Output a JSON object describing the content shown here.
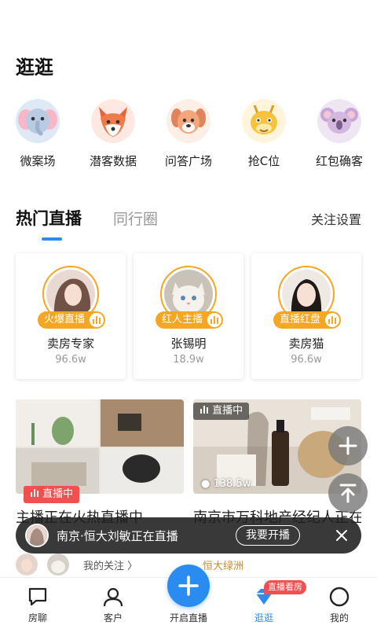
{
  "page": {
    "title": "逛逛"
  },
  "shortcuts": [
    {
      "label": "微案场",
      "icon": "elephant-icon"
    },
    {
      "label": "潜客数据",
      "icon": "fox-icon"
    },
    {
      "label": "问答广场",
      "icon": "dog-icon"
    },
    {
      "label": "抢C位",
      "icon": "dragon-icon"
    },
    {
      "label": "红包确客",
      "icon": "koala-icon"
    }
  ],
  "tabs": {
    "active": "热门直播",
    "inactive": "同行圈",
    "settings": "关注设置"
  },
  "streamers": [
    {
      "tag": "火爆直播",
      "name": "卖房专家",
      "count": "96.6w"
    },
    {
      "tag": "红人主播",
      "name": "张锡明",
      "count": "18.9w"
    },
    {
      "tag": "直播红盘",
      "name": "卖房猫",
      "count": "96.6w"
    }
  ],
  "rooms": [
    {
      "badge": "直播中",
      "title": "主播正在火热直播中"
    },
    {
      "badge": "直播中",
      "viewers": "138.5w",
      "title": "南京市万科地产经纪人正在直播"
    }
  ],
  "toast": {
    "text": "南京·恒大刘敏正在直播",
    "button": "我要开播"
  },
  "follow_strip": {
    "my_follow": "我的关注 〉",
    "estate": "恒大绿洲"
  },
  "nav": {
    "items": [
      {
        "label": "房聊",
        "icon": "chat-icon"
      },
      {
        "label": "客户",
        "icon": "person-icon"
      },
      {
        "label": "开启直播",
        "icon": "plus-icon"
      },
      {
        "label": "逛逛",
        "icon": "diamond-icon"
      },
      {
        "label": "我的",
        "icon": "profile-icon"
      }
    ],
    "badge": "直播看房",
    "active_index": 3
  },
  "colors": {
    "accent": "#2a8cf0",
    "tag_orange": "#f5a623",
    "live_red": "#f05050"
  }
}
